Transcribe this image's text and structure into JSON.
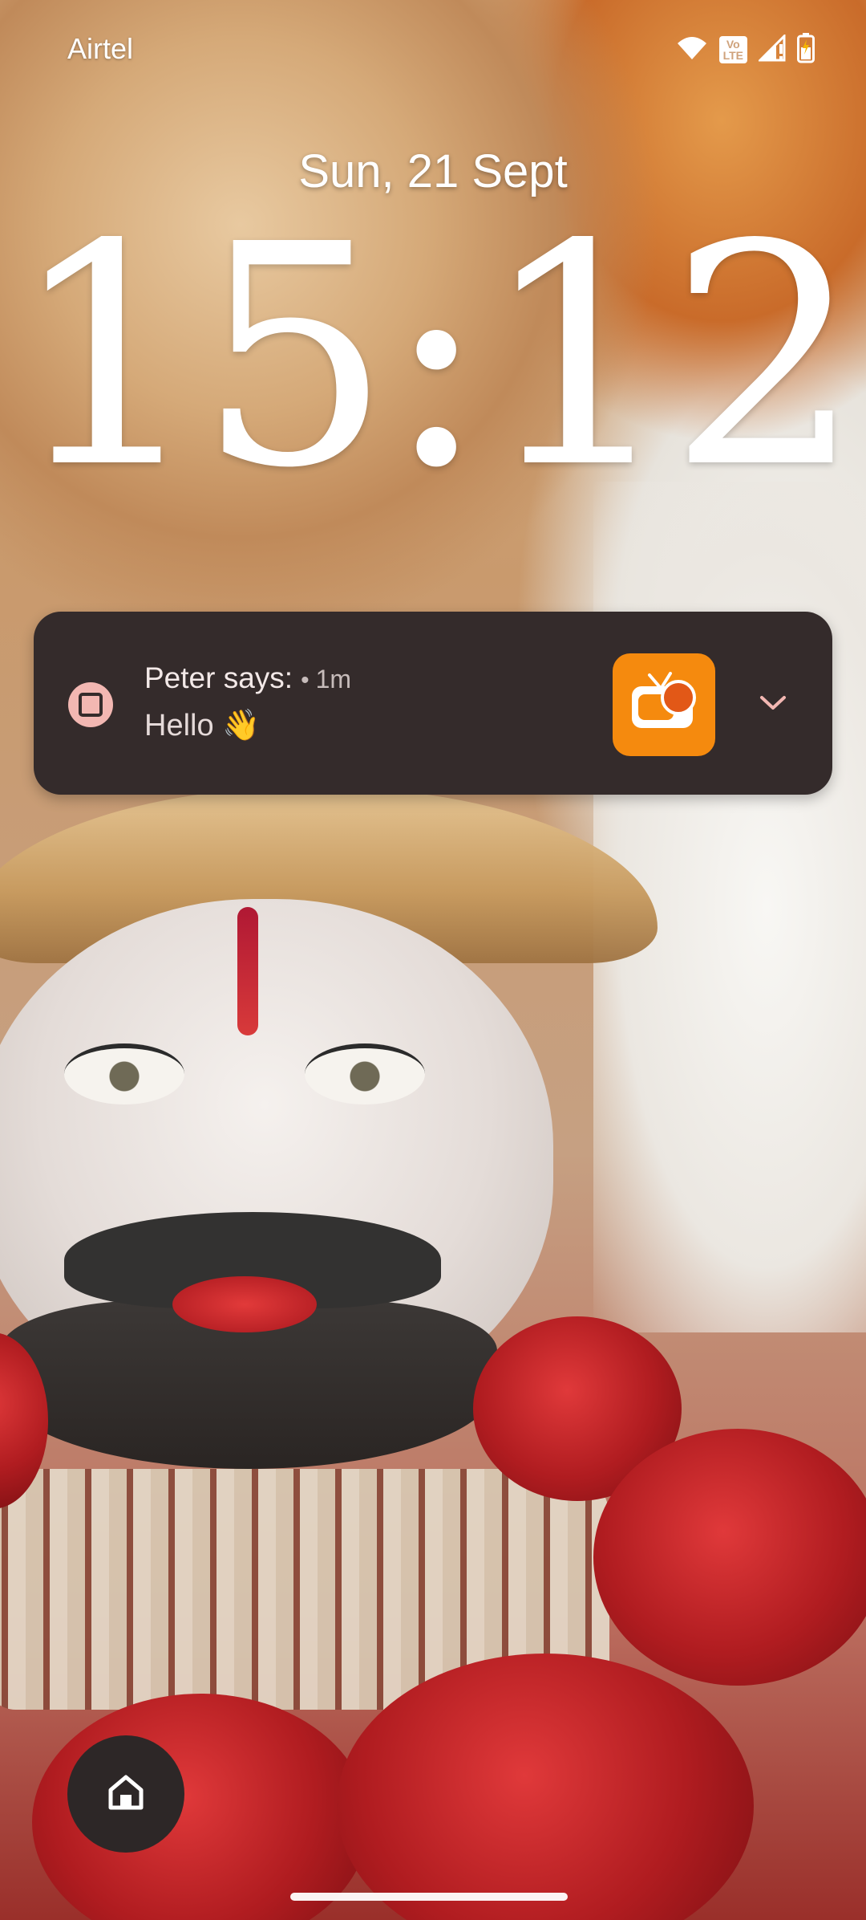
{
  "status_bar": {
    "carrier": "Airtel",
    "volte_label_top": "Vo",
    "volte_label_bottom": "LTE",
    "icons": [
      "wifi-icon",
      "volte-icon",
      "signal-icon",
      "battery-charging-icon"
    ]
  },
  "lockscreen": {
    "date": "Sun, 21 Sept",
    "time": "15:12"
  },
  "notification": {
    "sender": "Peter says:",
    "separator": "•",
    "time_ago": "1m",
    "message": "Hello 👋",
    "app_icon": "square-outline-icon",
    "thumbnail_icon": "tv-app-icon",
    "expand_icon": "chevron-down-icon",
    "colors": {
      "card_background": "#342b2b",
      "accent": "#f2b7b2",
      "thumbnail_background": "#f58a0e"
    }
  },
  "bottom": {
    "home_icon": "home-icon"
  }
}
